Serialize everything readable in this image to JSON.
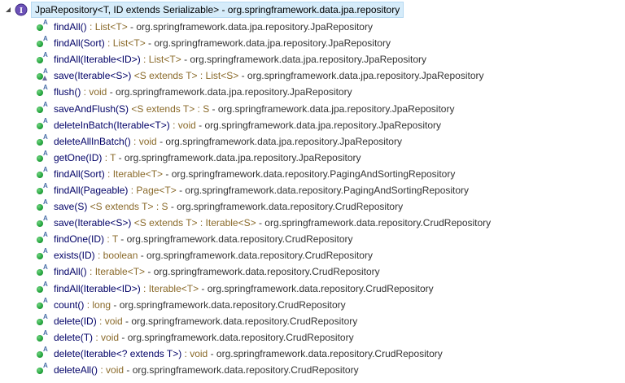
{
  "root": {
    "label": "JpaRepository<T, ID extends Serializable> - org.springframework.data.jpa.repository"
  },
  "methods": [
    {
      "name": "findAll()",
      "sig": " : List<T>",
      "loc": " - org.springframework.data.jpa.repository.JpaRepository",
      "override": false
    },
    {
      "name": "findAll(Sort)",
      "sig": " : List<T>",
      "loc": " - org.springframework.data.jpa.repository.JpaRepository",
      "override": false
    },
    {
      "name": "findAll(Iterable<ID>)",
      "sig": " : List<T>",
      "loc": " - org.springframework.data.jpa.repository.JpaRepository",
      "override": false
    },
    {
      "name": "save(Iterable<S>)",
      "sig": " <S extends T> : List<S>",
      "loc": " - org.springframework.data.jpa.repository.JpaRepository",
      "override": true
    },
    {
      "name": "flush()",
      "sig": " : void",
      "loc": " - org.springframework.data.jpa.repository.JpaRepository",
      "override": false
    },
    {
      "name": "saveAndFlush(S)",
      "sig": " <S extends T> : S",
      "loc": " - org.springframework.data.jpa.repository.JpaRepository",
      "override": false
    },
    {
      "name": "deleteInBatch(Iterable<T>)",
      "sig": " : void",
      "loc": " - org.springframework.data.jpa.repository.JpaRepository",
      "override": false
    },
    {
      "name": "deleteAllInBatch()",
      "sig": " : void",
      "loc": " - org.springframework.data.jpa.repository.JpaRepository",
      "override": false
    },
    {
      "name": "getOne(ID)",
      "sig": " : T",
      "loc": " - org.springframework.data.jpa.repository.JpaRepository",
      "override": false
    },
    {
      "name": "findAll(Sort)",
      "sig": " : Iterable<T>",
      "loc": " - org.springframework.data.repository.PagingAndSortingRepository",
      "override": false
    },
    {
      "name": "findAll(Pageable)",
      "sig": " : Page<T>",
      "loc": " - org.springframework.data.repository.PagingAndSortingRepository",
      "override": false
    },
    {
      "name": "save(S)",
      "sig": " <S extends T> : S",
      "loc": " - org.springframework.data.repository.CrudRepository",
      "override": false
    },
    {
      "name": "save(Iterable<S>)",
      "sig": " <S extends T> : Iterable<S>",
      "loc": " - org.springframework.data.repository.CrudRepository",
      "override": false
    },
    {
      "name": "findOne(ID)",
      "sig": " : T",
      "loc": " - org.springframework.data.repository.CrudRepository",
      "override": false
    },
    {
      "name": "exists(ID)",
      "sig": " : boolean",
      "loc": " - org.springframework.data.repository.CrudRepository",
      "override": false
    },
    {
      "name": "findAll()",
      "sig": " : Iterable<T>",
      "loc": " - org.springframework.data.repository.CrudRepository",
      "override": false
    },
    {
      "name": "findAll(Iterable<ID>)",
      "sig": " : Iterable<T>",
      "loc": " - org.springframework.data.repository.CrudRepository",
      "override": false
    },
    {
      "name": "count()",
      "sig": " : long",
      "loc": " - org.springframework.data.repository.CrudRepository",
      "override": false
    },
    {
      "name": "delete(ID)",
      "sig": " : void",
      "loc": " - org.springframework.data.repository.CrudRepository",
      "override": false
    },
    {
      "name": "delete(T)",
      "sig": " : void",
      "loc": " - org.springframework.data.repository.CrudRepository",
      "override": false
    },
    {
      "name": "delete(Iterable<? extends T>)",
      "sig": " : void",
      "loc": " - org.springframework.data.repository.CrudRepository",
      "override": false
    },
    {
      "name": "deleteAll()",
      "sig": " : void",
      "loc": " - org.springframework.data.repository.CrudRepository",
      "override": false
    }
  ],
  "icons": {
    "abstract_marker": "A",
    "interface_marker": "I",
    "public_method_color": "#22a33b",
    "interface_color": "#5a3fa0"
  }
}
